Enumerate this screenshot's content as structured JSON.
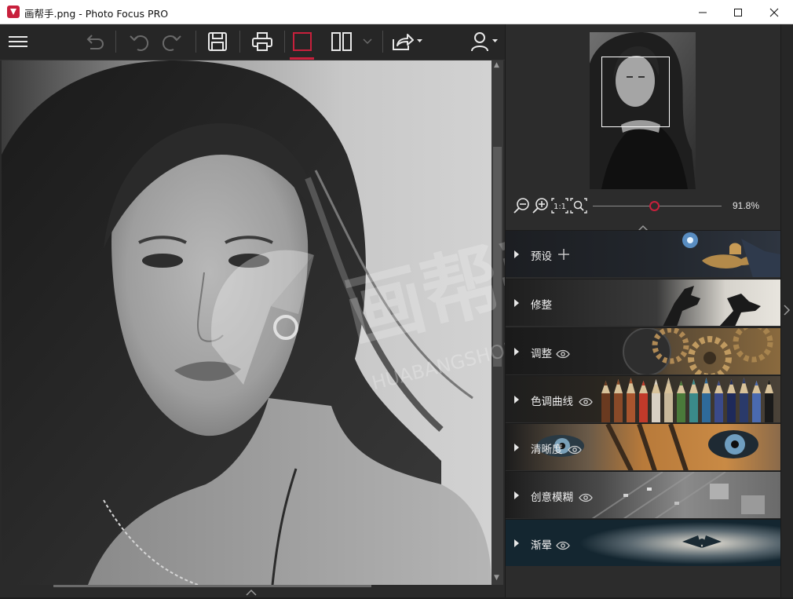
{
  "window": {
    "title": "画帮手.png - Photo Focus PRO",
    "controls": [
      "minimize",
      "maximize",
      "close"
    ]
  },
  "toolbar": {
    "items": [
      "menu",
      "undo-all",
      "undo",
      "redo",
      "save",
      "print",
      "single-view",
      "split-view",
      "split-dropdown",
      "share",
      "account"
    ],
    "active_item": "single-view",
    "accent_color": "#c8203c"
  },
  "navigator": {
    "zoom_label": "91.8%",
    "zoom_fraction": 0.5,
    "fit_label": "1:1"
  },
  "sections": [
    {
      "label": "预设",
      "icon": "plus-icon"
    },
    {
      "label": "修整",
      "icon": ""
    },
    {
      "label": "调整",
      "icon": "eye-icon"
    },
    {
      "label": "色调曲线",
      "icon": "eye-icon"
    },
    {
      "label": "清晰度",
      "icon": "eye-icon"
    },
    {
      "label": "创意模糊",
      "icon": "eye-icon"
    },
    {
      "label": "渐晕",
      "icon": "eye-icon"
    }
  ],
  "watermark": {
    "text": "画帮手",
    "sub_text": "HUABANGSHOU.COM"
  }
}
